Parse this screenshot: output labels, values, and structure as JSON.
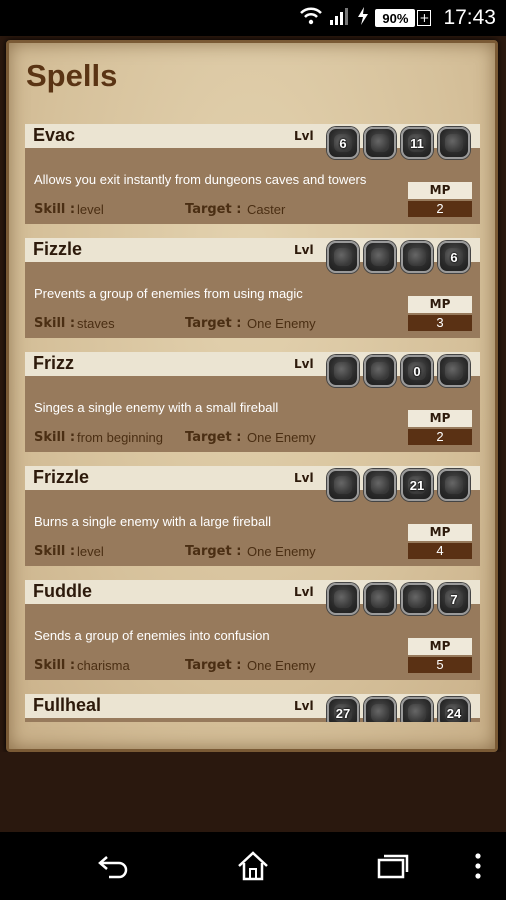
{
  "status_bar": {
    "battery": "90%",
    "time": "17:43",
    "icons": [
      "wifi-icon",
      "signal-icon",
      "charging-icon",
      "battery-icon",
      "plus-icon"
    ]
  },
  "screen": {
    "title": "Spells"
  },
  "labels": {
    "lvl": "Lvl",
    "mp": "MP",
    "skill": "Skill :",
    "target": "Target :"
  },
  "spells": [
    {
      "name": "Evac",
      "levels": [
        "6",
        "",
        "11",
        ""
      ],
      "description": "Allows you exit instantly from dungeons caves and towers",
      "skill": "level",
      "target": "Caster",
      "mp": "2"
    },
    {
      "name": "Fizzle",
      "levels": [
        "",
        "",
        "",
        "6"
      ],
      "description": "Prevents a group of enemies from using magic",
      "skill": "staves",
      "target": "One Enemy",
      "mp": "3"
    },
    {
      "name": "Frizz",
      "levels": [
        "",
        "",
        "0",
        ""
      ],
      "description": "Singes a single enemy with a small fireball",
      "skill": "from beginning",
      "target": "One Enemy",
      "mp": "2"
    },
    {
      "name": "Frizzle",
      "levels": [
        "",
        "",
        "21",
        ""
      ],
      "description": "Burns a single enemy with a large fireball",
      "skill": "level",
      "target": "One Enemy",
      "mp": "4"
    },
    {
      "name": "Fuddle",
      "levels": [
        "",
        "",
        "",
        "7"
      ],
      "description": "Sends a group of enemies into confusion",
      "skill": "charisma",
      "target": "One Enemy",
      "mp": "5"
    },
    {
      "name": "Fullheal",
      "levels": [
        "27",
        "",
        "",
        "24"
      ],
      "description": "",
      "skill": "",
      "target": "",
      "mp": ""
    }
  ],
  "nav": {
    "icons": [
      "back-icon",
      "home-icon",
      "recent-apps-icon",
      "overflow-menu-icon"
    ]
  },
  "colors": {
    "parchment": "#d8c49f",
    "card": "#977a5c",
    "card_header": "#ebe4d2",
    "title": "#5a3414",
    "mp_value_bg": "#5a3114"
  }
}
